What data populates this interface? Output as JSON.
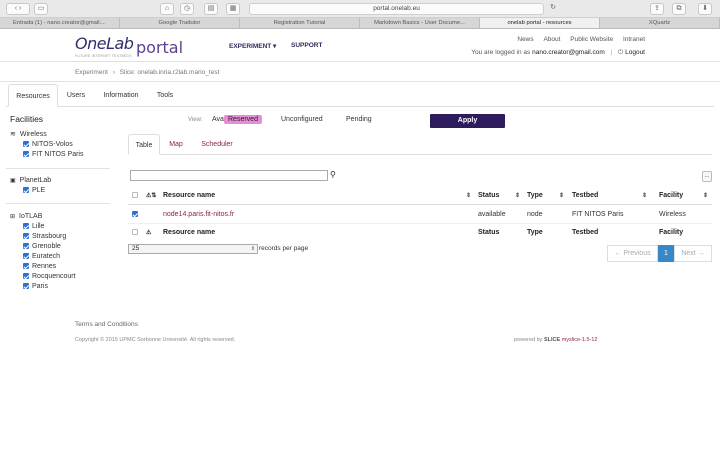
{
  "browser": {
    "url": "portal.onelab.eu",
    "tabs": [
      "Entrada (1) - nano.creator@gmail....",
      "Google Tradutor",
      "Registration Tutorial",
      "Markdown Basics - User Docume...",
      "onelab portal - resources",
      "XQuartz"
    ],
    "active_tab": 4
  },
  "header": {
    "logo_main": "OneLab",
    "logo_sub": "portal",
    "logo_tagline": "FUTURE INTERNET TESTBEDS",
    "nav_experiment": "EXPERIMENT ▾",
    "nav_support": "SUPPORT",
    "top_links": [
      "News",
      "About",
      "Public Website",
      "Intranet"
    ],
    "logged_in_prefix": "You are logged in as",
    "user_email": "nano.creator@gmail.com",
    "separator": "|",
    "logout": "Logout"
  },
  "breadcrumb": {
    "root": "Experiment",
    "sep": "›",
    "current": "Slice: onelab.inria.r2lab.mario_test"
  },
  "main_tabs": [
    "Resources",
    "Users",
    "Information",
    "Tools"
  ],
  "sidebar": {
    "title": "Facilities",
    "groups": [
      {
        "name": "Wireless",
        "items": [
          "NITOS-Volos",
          "FIT NITOS Paris"
        ]
      },
      {
        "name": "PlanetLab",
        "items": [
          "PLE"
        ]
      },
      {
        "name": "IoTLAB",
        "items": [
          "Lille",
          "Strasbourg",
          "Grenoble",
          "Euratech",
          "Rennes",
          "Rocquencourt",
          "Paris"
        ]
      }
    ]
  },
  "view": {
    "label": "View:",
    "options": [
      "Available",
      "Reserved",
      "Unconfigured",
      "Pending"
    ],
    "selected": "Reserved",
    "apply": "Apply"
  },
  "sub_tabs": [
    "Table",
    "Map",
    "Scheduler"
  ],
  "table": {
    "columns": [
      "Resource name",
      "Status",
      "Type",
      "Testbed",
      "Facility"
    ],
    "rows": [
      {
        "name": "node14.paris.fit-nitos.fr",
        "status": "available",
        "type": "node",
        "testbed": "FIT NITOS Paris",
        "facility": "Wireless"
      }
    ],
    "ellipsis": "..."
  },
  "paging": {
    "per_page_value": "25",
    "per_page_label": "records per page",
    "previous": "← Previous",
    "page": "1",
    "next": "Next →"
  },
  "footer": {
    "terms": "Terms and Conditions",
    "copyright": "Copyright © 2015 UPMC Sorbonne Université. All rights reserved.",
    "powered_by": "powered by",
    "powered_brand": "SLICE",
    "version": "myslice-1.5-12"
  },
  "colors": {
    "brand_dark": "#2d1b5e",
    "reserved_highlight": "#e88bd8",
    "link": "#8b2346",
    "checkbox": "#2f6fd1"
  }
}
